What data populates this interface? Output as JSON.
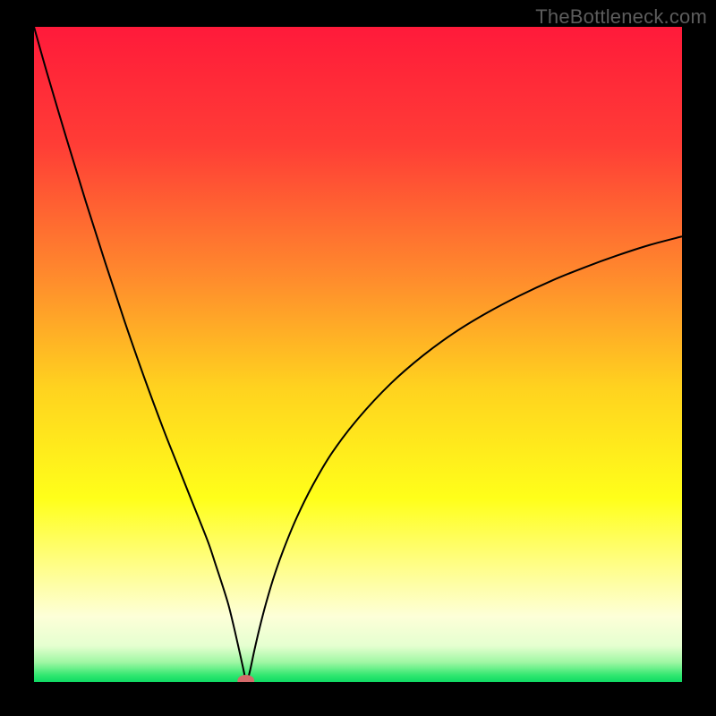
{
  "watermark": "TheBottleneck.com",
  "chart_data": {
    "type": "line",
    "title": "",
    "xlabel": "",
    "ylabel": "",
    "xlim": [
      0,
      100
    ],
    "ylim": [
      0,
      100
    ],
    "background_gradient": {
      "stops": [
        {
          "t": 0.0,
          "color": "#ff1a3a"
        },
        {
          "t": 0.18,
          "color": "#ff3d36"
        },
        {
          "t": 0.38,
          "color": "#ff8a2d"
        },
        {
          "t": 0.55,
          "color": "#ffd21f"
        },
        {
          "t": 0.72,
          "color": "#ffff1a"
        },
        {
          "t": 0.82,
          "color": "#fffe85"
        },
        {
          "t": 0.9,
          "color": "#fdffd8"
        },
        {
          "t": 0.945,
          "color": "#e5ffd0"
        },
        {
          "t": 0.97,
          "color": "#9ff7a3"
        },
        {
          "t": 0.99,
          "color": "#2fe76f"
        },
        {
          "t": 1.0,
          "color": "#0fd964"
        }
      ]
    },
    "series": [
      {
        "name": "bottleneck-curve",
        "stroke": "#000000",
        "stroke_width": 2,
        "x": [
          0.0,
          2.0,
          5.0,
          8.0,
          11.0,
          14.0,
          17.0,
          20.0,
          22.0,
          24.0,
          25.5,
          27.0,
          28.0,
          29.0,
          30.0,
          30.8,
          31.4,
          31.9,
          32.3,
          32.55,
          32.7,
          33.0,
          33.4,
          34.0,
          34.8,
          35.8,
          37.0,
          38.5,
          40.5,
          43.0,
          46.0,
          50.0,
          55.0,
          60.0,
          65.0,
          70.0,
          75.0,
          80.0,
          85.0,
          90.0,
          95.0,
          100.0
        ],
        "y": [
          100.0,
          93.0,
          83.0,
          73.3,
          64.0,
          55.0,
          46.5,
          38.5,
          33.5,
          28.5,
          24.8,
          21.0,
          18.0,
          15.0,
          11.8,
          8.6,
          6.0,
          3.8,
          2.0,
          0.8,
          0.2,
          0.5,
          2.0,
          4.8,
          8.2,
          12.0,
          16.0,
          20.2,
          25.0,
          30.0,
          35.0,
          40.2,
          45.5,
          49.8,
          53.4,
          56.4,
          59.0,
          61.3,
          63.3,
          65.1,
          66.7,
          68.0
        ]
      }
    ],
    "marker": {
      "name": "optimum-marker",
      "x": 32.7,
      "y": 0.2,
      "rx": 1.3,
      "ry": 0.9,
      "fill": "#d46a6a"
    }
  }
}
